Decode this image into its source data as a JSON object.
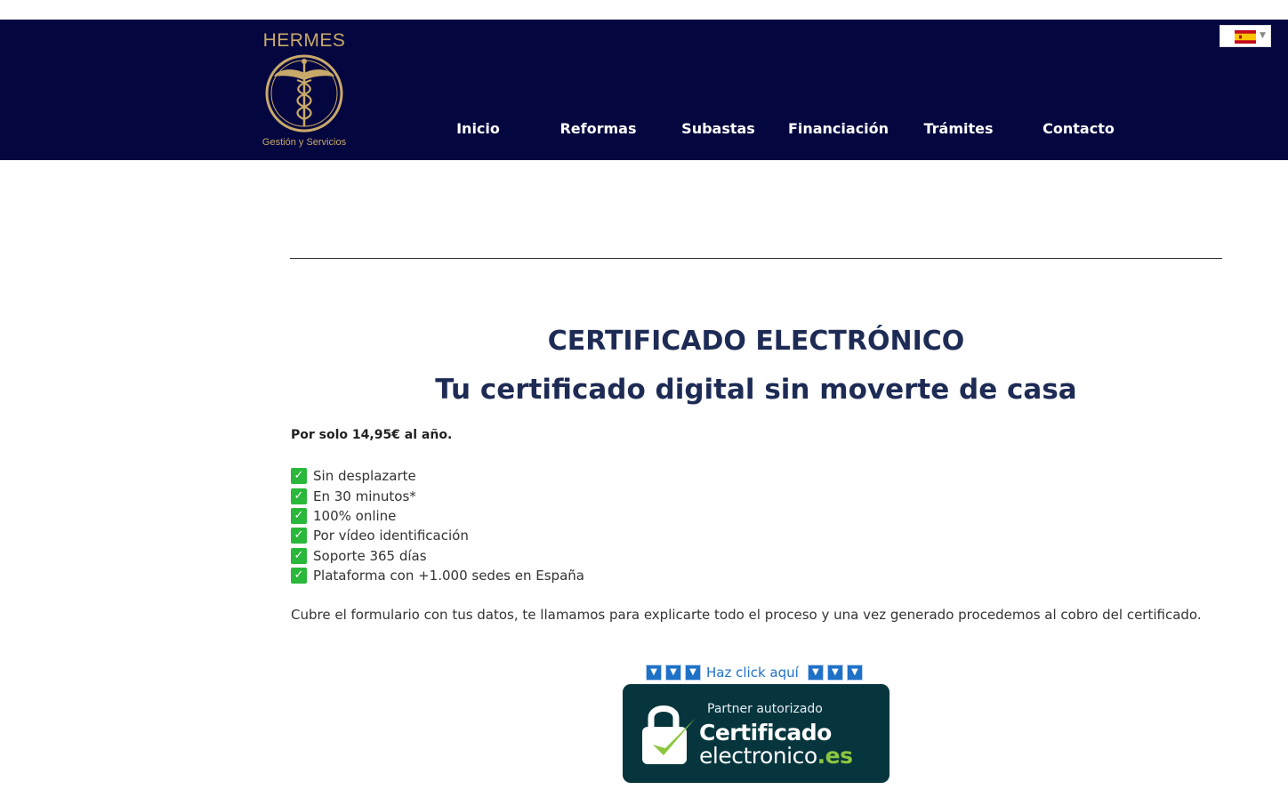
{
  "header": {
    "logo": {
      "title": "HERMES",
      "subtitle": "Gestión y Servicios",
      "emblem_icon": "caduceus-icon"
    },
    "nav": [
      {
        "label": "Inicio"
      },
      {
        "label": "Reformas"
      },
      {
        "label": "Subastas"
      },
      {
        "label": "Financiación"
      },
      {
        "label": "Trámites"
      },
      {
        "label": "Contacto"
      }
    ],
    "language": {
      "flag_icon": "spain-flag-icon",
      "caret_icon": "caret-down-icon"
    }
  },
  "main": {
    "title": "CERTIFICADO ELECTRÓNICO",
    "subtitle": "Tu certificado digital sin moverte de casa",
    "price": "Por solo 14,95€ al año.",
    "features": [
      "Sin desplazarte",
      "En 30 minutos*",
      "100% online",
      "Por vídeo identificación",
      "Soporte 365 días",
      "Plataforma con +1.000 sedes en España"
    ],
    "description": "Cubre el formulario con tus datos, te llamamos para explicarte todo el proceso y una vez generado procedemos al cobro del certificado.",
    "click_label": "Haz click aquí",
    "badge": {
      "partner": "Partner autorizado",
      "brand_main": "Certificado",
      "brand_elec": "electronico",
      "brand_tld": ".es"
    }
  },
  "colors": {
    "header_bg": "#04063f",
    "gold": "#c8a96a",
    "title": "#1d2b55",
    "check_green": "#29b83a",
    "link_blue": "#1f71c8",
    "badge_bg": "#06353e",
    "badge_green": "#8cc63f"
  }
}
